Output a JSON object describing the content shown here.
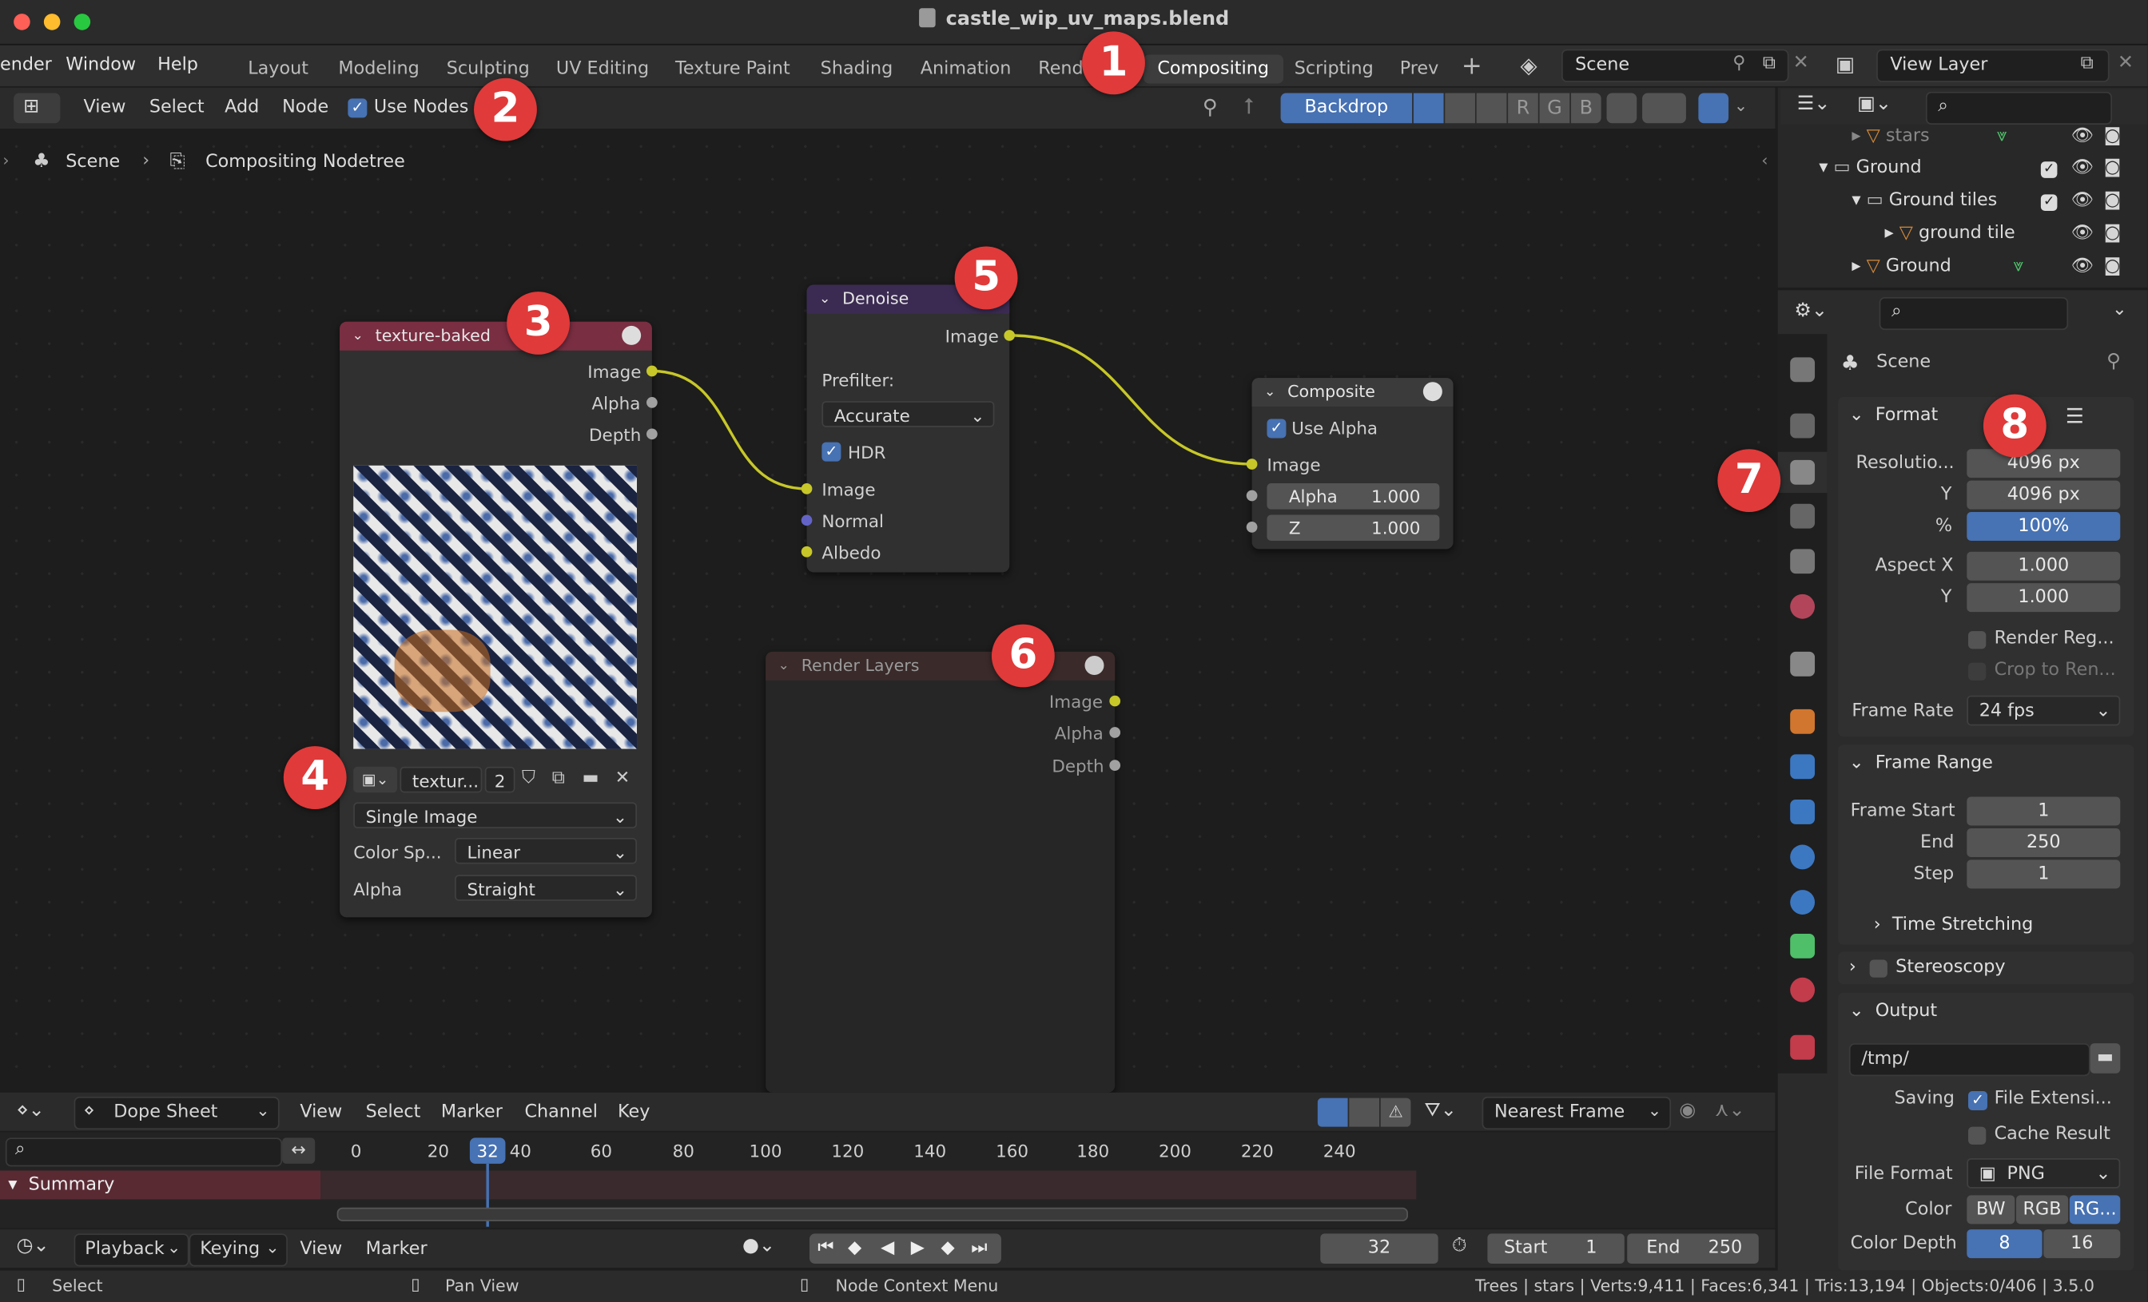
{
  "window": {
    "title": "castle_wip_uv_maps.blend"
  },
  "menu": {
    "render": "ender",
    "window": "Window",
    "help": "Help"
  },
  "workspaces": [
    "Layout",
    "Modeling",
    "Sculpting",
    "UV Editing",
    "Texture Paint",
    "Shading",
    "Animation",
    "Rend",
    "Compositing",
    "Scripting",
    "Prev"
  ],
  "scene_field": "Scene",
  "view_layer_field": "View Layer",
  "node_header": {
    "view": "View",
    "select": "Select",
    "add": "Add",
    "node": "Node",
    "use_nodes": "Use Nodes",
    "backdrop": "Backdrop",
    "r": "R",
    "g": "G",
    "b": "B"
  },
  "breadcrumb": {
    "scene": "Scene",
    "tree": "Compositing Nodetree"
  },
  "nodes": {
    "texture": {
      "title": "texture-baked",
      "outputs": [
        "Image",
        "Alpha",
        "Depth"
      ],
      "image_name": "textur...",
      "users": "2",
      "source": "Single Image",
      "colorspace_label": "Color Sp...",
      "colorspace": "Linear",
      "alpha_label": "Alpha",
      "alpha": "Straight"
    },
    "denoise": {
      "title": "Denoise",
      "out_image": "Image",
      "prefilter_label": "Prefilter:",
      "prefilter": "Accurate",
      "hdr": "HDR",
      "inputs": [
        "Image",
        "Normal",
        "Albedo"
      ]
    },
    "composite": {
      "title": "Composite",
      "use_alpha": "Use Alpha",
      "image": "Image",
      "alpha_label": "Alpha",
      "alpha_val": "1.000",
      "z_label": "Z",
      "z_val": "1.000"
    },
    "render_layers": {
      "title": "Render Layers",
      "outputs": [
        "Image",
        "Alpha",
        "Depth"
      ]
    }
  },
  "badges": [
    "1",
    "2",
    "3",
    "4",
    "5",
    "6",
    "7",
    "8"
  ],
  "outliner": {
    "items": [
      "stars",
      "Ground",
      "Ground tiles",
      "ground tile",
      "Ground"
    ]
  },
  "properties": {
    "scene": "Scene",
    "format": {
      "title": "Format",
      "res_label": "Resolutio...",
      "res_x": "4096 px",
      "y_label": "Y",
      "res_y": "4096 px",
      "pct_label": "%",
      "pct": "100%",
      "aspect_x_label": "Aspect X",
      "aspect_x": "1.000",
      "aspect_y_label": "Y",
      "aspect_y": "1.000",
      "render_region": "Render Reg...",
      "crop": "Crop to Ren...",
      "frame_rate_label": "Frame Rate",
      "frame_rate": "24 fps"
    },
    "frame_range": {
      "title": "Frame Range",
      "start_label": "Frame Start",
      "start": "1",
      "end_label": "End",
      "end": "250",
      "step_label": "Step",
      "step": "1",
      "time_stretching": "Time Stretching"
    },
    "stereoscopy": "Stereoscopy",
    "output": {
      "title": "Output",
      "path": "/tmp/",
      "saving_label": "Saving",
      "file_ext": "File Extensi...",
      "cache": "Cache Result",
      "format_label": "File Format",
      "format": "PNG",
      "color_label": "Color",
      "bw": "BW",
      "rgb": "RGB",
      "rgba": "RG...",
      "depth_label": "Color Depth",
      "d8": "8",
      "d16": "16"
    }
  },
  "dopesheet": {
    "editor": "Dope Sheet",
    "view": "View",
    "select": "Select",
    "marker": "Marker",
    "channel": "Channel",
    "key": "Key",
    "snap": "Nearest Frame",
    "summary": "Summary",
    "ticks": [
      "0",
      "20",
      "40",
      "60",
      "80",
      "100",
      "120",
      "140",
      "160",
      "180",
      "200",
      "220",
      "240"
    ],
    "current": "32"
  },
  "timeline": {
    "playback": "Playback",
    "keying": "Keying",
    "view": "View",
    "marker": "Marker",
    "frame": "32",
    "start_label": "Start",
    "start": "1",
    "end_label": "End",
    "end": "250"
  },
  "status": {
    "select": "Select",
    "pan": "Pan View",
    "ctx": "Node Context Menu",
    "stats": "Trees | stars | Verts:9,411 | Faces:6,341 | Tris:13,194 | Objects:0/406 | 3.5.0"
  },
  "colors": {
    "accent": "#4772b3",
    "badge": "#e03a3a",
    "socket_yellow": "#c7c729"
  }
}
